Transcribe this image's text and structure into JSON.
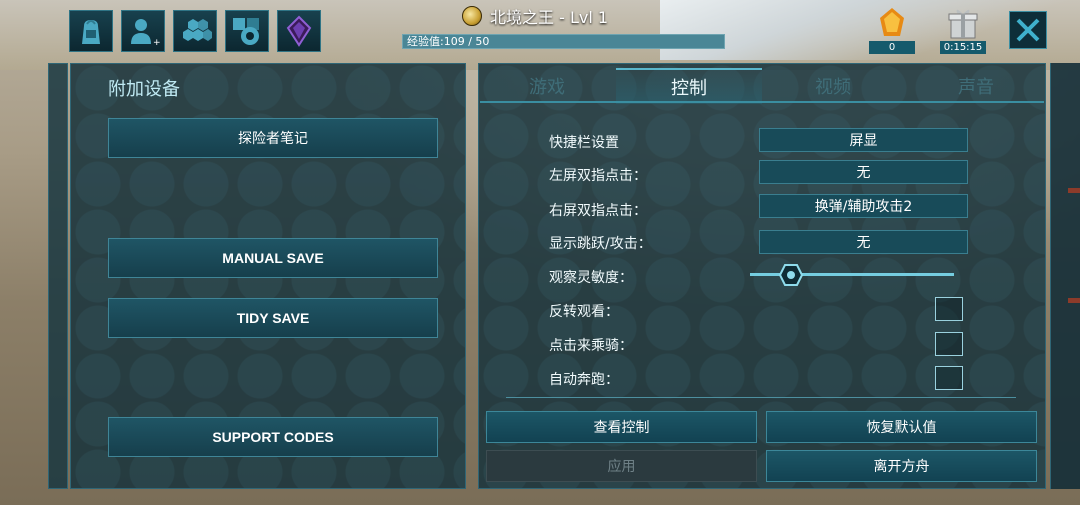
{
  "header": {
    "title": "北境之王 - Lvl 1",
    "xp_text": "经验值:109 / 50",
    "xp_fraction": 1.0,
    "icons": [
      "backpack-icon",
      "add-player-icon",
      "hexagons-icon",
      "settings-gear-icon",
      "purple-crystal-icon"
    ],
    "amber": {
      "icon": "amber-crystal-icon",
      "value": "0"
    },
    "gift": {
      "icon": "gift-box-icon",
      "value": "0:15:15"
    },
    "close_icon": "close-x-icon"
  },
  "left_panel": {
    "title": "附加设备",
    "buttons": {
      "explorer_notes": "探险者笔记",
      "manual_save": "MANUAL SAVE",
      "tidy_save": "TIDY SAVE",
      "support_codes": "SUPPORT CODES"
    }
  },
  "tabs": [
    {
      "label": "游戏",
      "active": false
    },
    {
      "label": "控制",
      "active": true
    },
    {
      "label": "视频",
      "active": false
    },
    {
      "label": "声音",
      "active": false
    }
  ],
  "controls": {
    "hotbar": {
      "label": "快捷栏设置",
      "value": "屏显"
    },
    "left_double_tap": {
      "label": "左屏双指点击：",
      "value": "无"
    },
    "right_double_tap": {
      "label": "右屏双指点击：",
      "value": "换弹/辅助攻击2"
    },
    "show_jump_attack": {
      "label": "显示跳跃/攻击：",
      "value": "无"
    },
    "look_sensitivity": {
      "label": "观察灵敏度：",
      "value_fraction": 0.2
    },
    "invert_look": {
      "label": "反转观看：",
      "checked": false
    },
    "tap_to_ride": {
      "label": "点击来乘骑：",
      "checked": false
    },
    "auto_run": {
      "label": "自动奔跑：",
      "checked": false
    }
  },
  "footer": {
    "view_controls": "查看控制",
    "restore_defaults": "恢复默认值",
    "apply": "应用",
    "leave_ark": "离开方舟"
  },
  "colors": {
    "panel": "#1a343c",
    "accent": "#59b7cc",
    "button": "#1c5666",
    "text": "#ffffff"
  }
}
